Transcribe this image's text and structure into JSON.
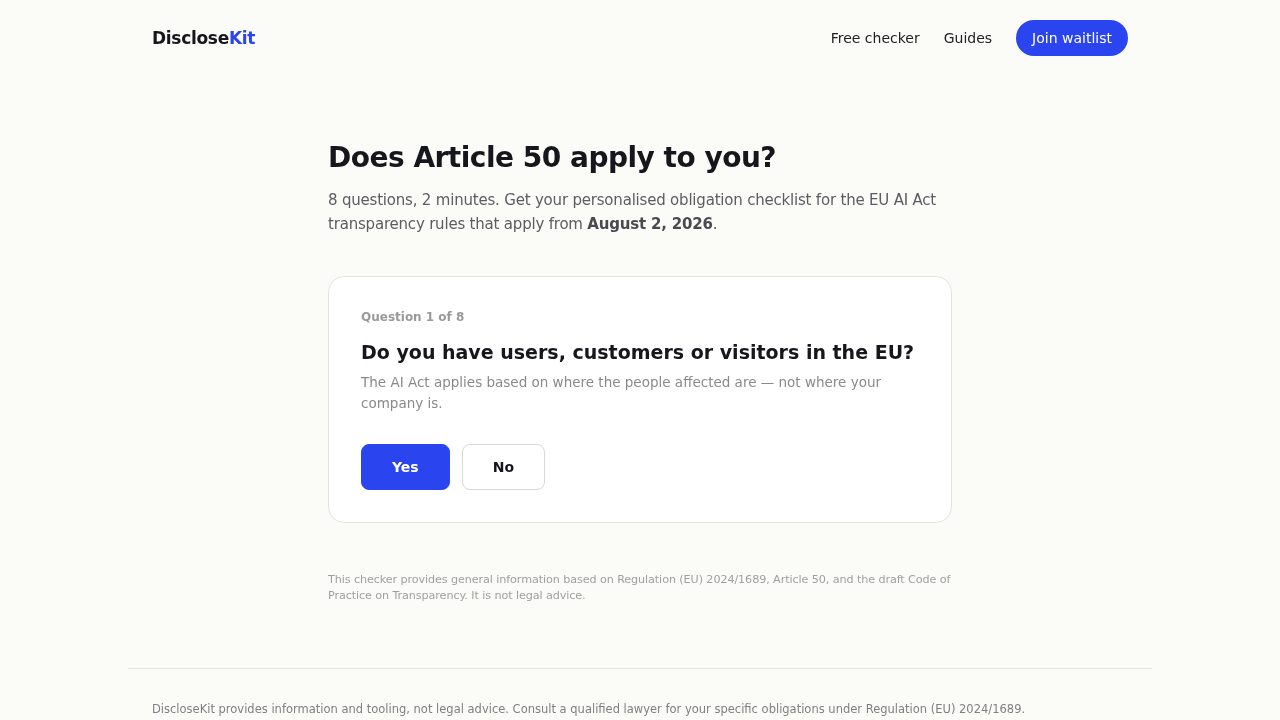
{
  "header": {
    "logo": {
      "text": "Disclose",
      "accent": "Kit"
    },
    "nav": [
      {
        "label": "Free checker"
      },
      {
        "label": "Guides"
      }
    ],
    "cta": "Join waitlist"
  },
  "intro": {
    "title": "Does Article 50 apply to you?",
    "subtitle": "8 questions, 2 minutes. Get your personalised obligation checklist for the EU AI Act transparency rules that apply from **August 2, 2026**."
  },
  "question": {
    "counter": "Question 1 of 8",
    "title": "Do you have users, customers or visitors in the EU?",
    "help": "The AI Act applies based on where the people affected are — not where your company is.",
    "answers": [
      {
        "label": "Yes",
        "kind": "primary"
      },
      {
        "label": "No",
        "kind": "secondary"
      }
    ]
  },
  "disclaimer": "This checker provides general information based on Regulation (EU) 2024/1689, Article 50, and the draft Code of Practice on Transparency. It is not legal advice.",
  "footer": {
    "text": "DiscloseKit provides information and tooling, not legal advice. Consult a qualified lawyer for your specific obligations under Regulation (EU) 2024/1689."
  }
}
